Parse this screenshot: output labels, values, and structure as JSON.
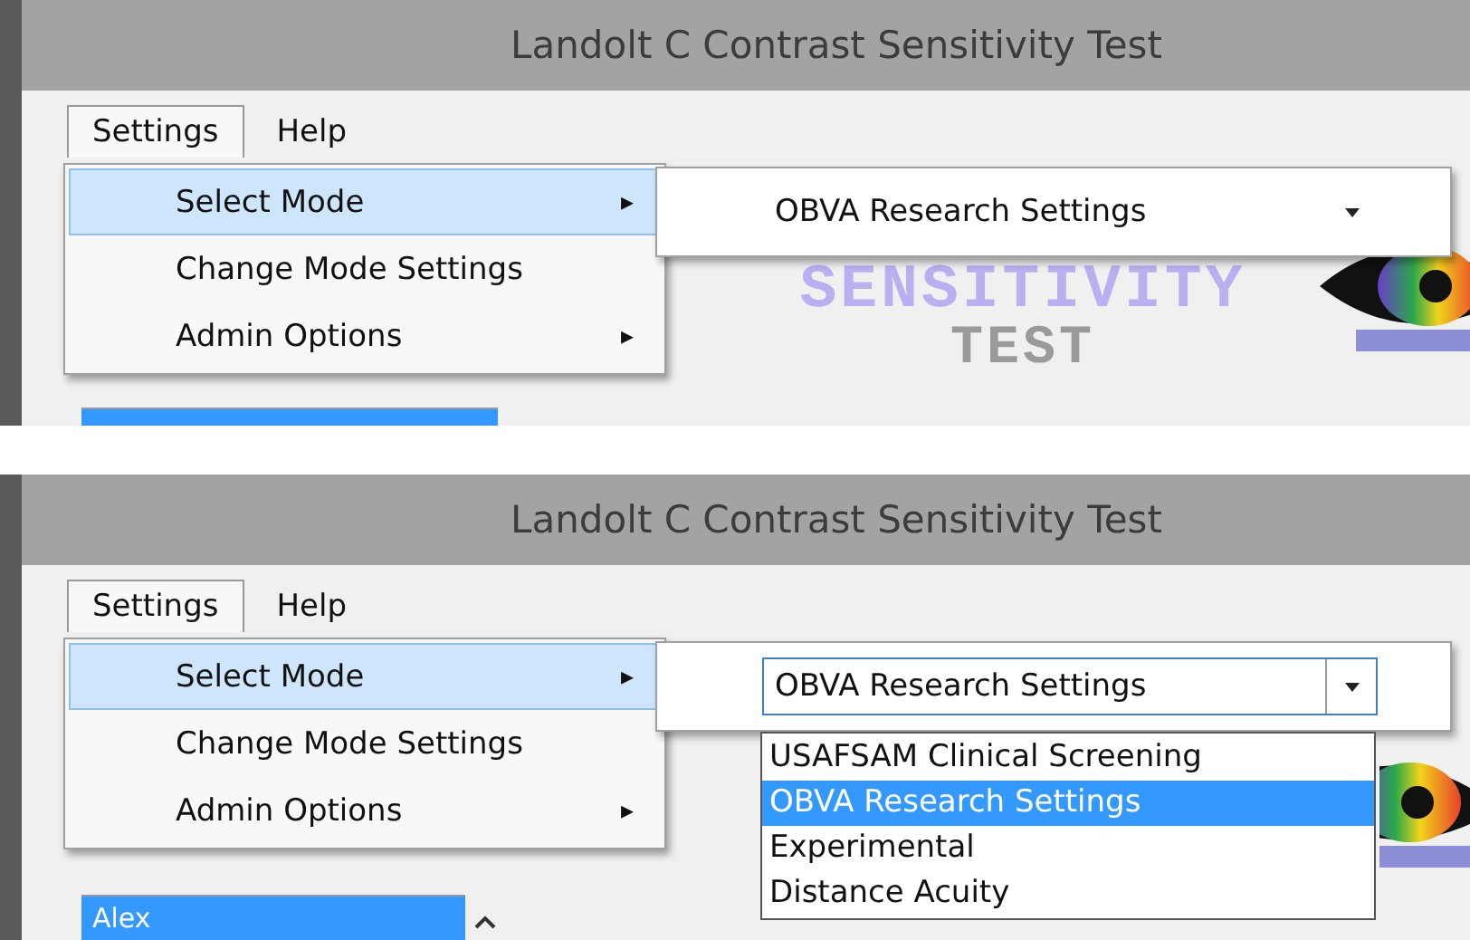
{
  "panels": [
    {
      "title": "Landolt C Contrast Sensitivity Test",
      "menubar": [
        {
          "label": "Settings",
          "selected": true
        },
        {
          "label": "Help",
          "selected": false
        }
      ],
      "menu": [
        {
          "label": "Select Mode",
          "selected": true,
          "arrow": "▸"
        },
        {
          "label": "Change Mode Settings",
          "selected": false
        },
        {
          "label": "Admin Options",
          "selected": false,
          "arrow": "▸"
        }
      ],
      "mode_combo": {
        "value": "OBVA Research Settings",
        "expanded": false
      },
      "logo": {
        "lines": [
          "SENSITIVITY",
          "TEST"
        ]
      },
      "user_list": [
        {
          "selected": true
        }
      ]
    },
    {
      "title": "Landolt C Contrast Sensitivity Test",
      "menubar": [
        {
          "label": "Settings",
          "selected": true
        },
        {
          "label": "Help",
          "selected": false
        }
      ],
      "menu": [
        {
          "label": "Select Mode",
          "selected": true,
          "arrow": "▸"
        },
        {
          "label": "Change Mode Settings",
          "selected": false
        },
        {
          "label": "Admin Options",
          "selected": false,
          "arrow": "▸"
        }
      ],
      "mode_combo": {
        "value": "OBVA Research Settings",
        "expanded": true,
        "options": [
          {
            "label": "USAFSAM Clinical Screening",
            "selected": false
          },
          {
            "label": "OBVA Research Settings",
            "selected": true
          },
          {
            "label": "Experimental",
            "selected": false
          },
          {
            "label": "Distance Acuity",
            "selected": false
          }
        ]
      },
      "user_list": [
        {
          "label": "Alex",
          "selected": true
        }
      ]
    }
  ]
}
